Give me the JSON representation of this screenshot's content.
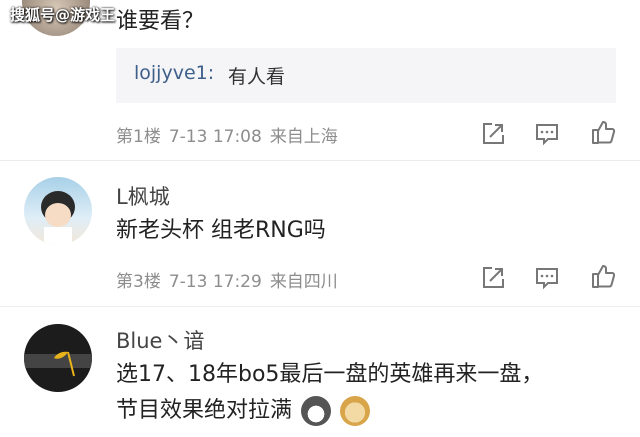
{
  "watermark": "搜狐号@游戏王",
  "comments": [
    {
      "text": "谁要看？",
      "reply": {
        "user": "lojjyve1:",
        "text": "有人看"
      },
      "floor": "第1楼",
      "time": "7-13 17:08",
      "location": "来自上海"
    },
    {
      "name": "L枫城",
      "text": "新老头杯 组老RNG吗",
      "floor": "第3楼",
      "time": "7-13 17:29",
      "location": "来自四川"
    },
    {
      "name": "Blue丶谙",
      "text_line1": "选17、18年bo5最后一盘的英雄再来一盘，",
      "text_line2": "节目效果绝对拉满"
    }
  ],
  "icons": [
    "share-icon",
    "comment-icon",
    "like-icon"
  ],
  "colors": {
    "reply_user": "#3f5f8a",
    "meta": "#8d8d8d",
    "reply_bg": "#f5f5f7"
  }
}
